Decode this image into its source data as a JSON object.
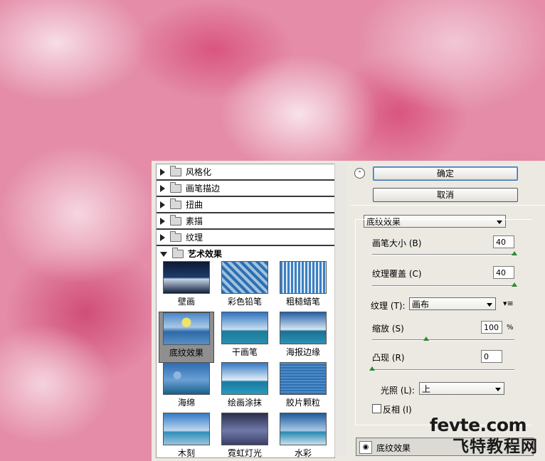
{
  "categories": [
    {
      "label": "风格化",
      "expanded": false
    },
    {
      "label": "画笔描边",
      "expanded": false
    },
    {
      "label": "扭曲",
      "expanded": false
    },
    {
      "label": "素描",
      "expanded": false
    },
    {
      "label": "纹理",
      "expanded": false
    },
    {
      "label": "艺术效果",
      "expanded": true
    }
  ],
  "filters": [
    {
      "label": "壁画",
      "selected": false
    },
    {
      "label": "彩色铅笔",
      "selected": false
    },
    {
      "label": "粗糙蜡笔",
      "selected": false
    },
    {
      "label": "底纹效果",
      "selected": true
    },
    {
      "label": "干画笔",
      "selected": false
    },
    {
      "label": "海报边缘",
      "selected": false
    },
    {
      "label": "海绵",
      "selected": false
    },
    {
      "label": "绘画涂抹",
      "selected": false
    },
    {
      "label": "胶片颗粒",
      "selected": false
    },
    {
      "label": "木刻",
      "selected": false
    },
    {
      "label": "霓虹灯光",
      "selected": false
    },
    {
      "label": "水彩",
      "selected": false
    }
  ],
  "buttons": {
    "ok": "确定",
    "cancel": "取消"
  },
  "filter_select": "底纹效果",
  "params": {
    "brush_size": {
      "label": "画笔大小 (B)",
      "value": "40",
      "level": 1.0
    },
    "texture_coverage": {
      "label": "纹理覆盖 (C)",
      "value": "40",
      "level": 1.0
    },
    "texture": {
      "label": "纹理 (T):",
      "value": "画布"
    },
    "scaling": {
      "label": "缩放 (S)",
      "value": "100",
      "unit": "%",
      "level": 0.38
    },
    "relief": {
      "label": "凸现 (R)",
      "value": "0",
      "level": 0.0
    },
    "light": {
      "label": "光照 (L):",
      "value": "上"
    },
    "invert": {
      "label": "反相 (I)",
      "checked": false
    }
  },
  "layer": {
    "label": "底纹效果"
  },
  "watermark": {
    "line1": "fevte.com",
    "line2": "飞特教程网"
  },
  "colors": {
    "accent_green": "#2f8a30",
    "ok_border": "#3a6fb3"
  }
}
